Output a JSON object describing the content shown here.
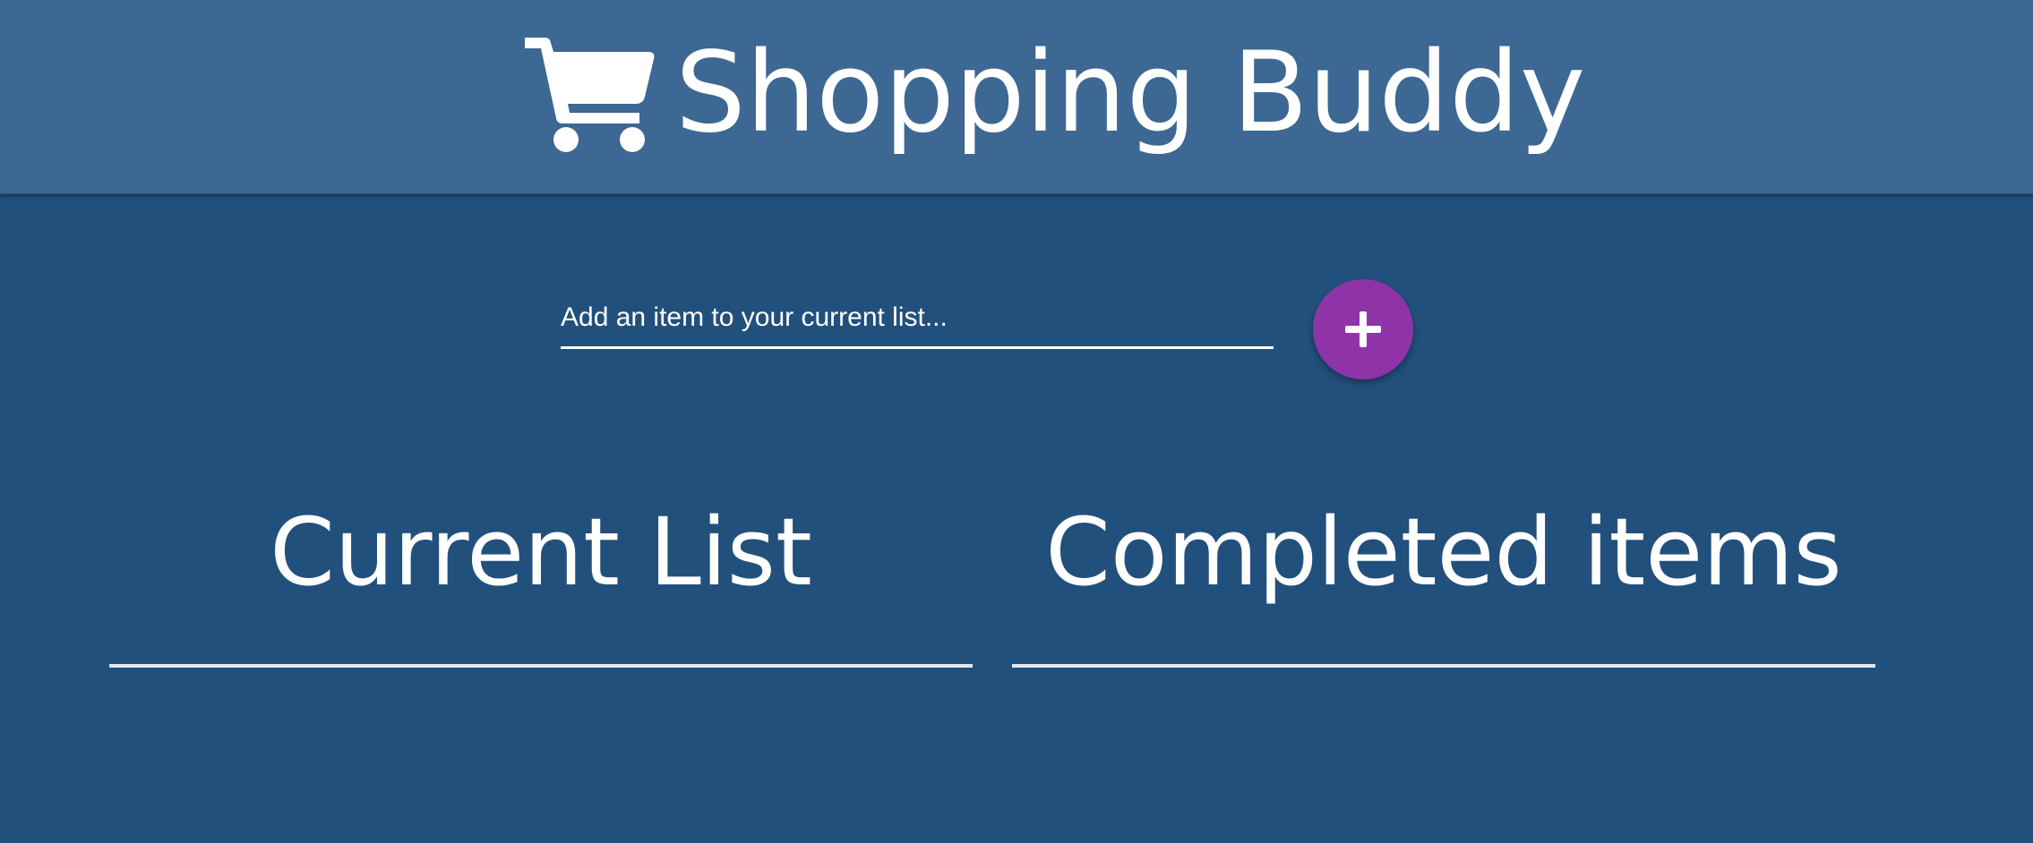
{
  "header": {
    "icon": "shopping-cart-icon",
    "title": "Shopping Buddy"
  },
  "add_form": {
    "input_placeholder": "Add an item to your current list...",
    "input_value": "",
    "add_button_icon": "plus-icon",
    "add_button_color": "#8e34a8"
  },
  "lists": {
    "current": {
      "heading": "Current List",
      "items": []
    },
    "completed": {
      "heading": "Completed items",
      "items": []
    }
  },
  "colors": {
    "header_background": "#3c6893",
    "page_background": "#22507c",
    "text": "#ffffff"
  }
}
